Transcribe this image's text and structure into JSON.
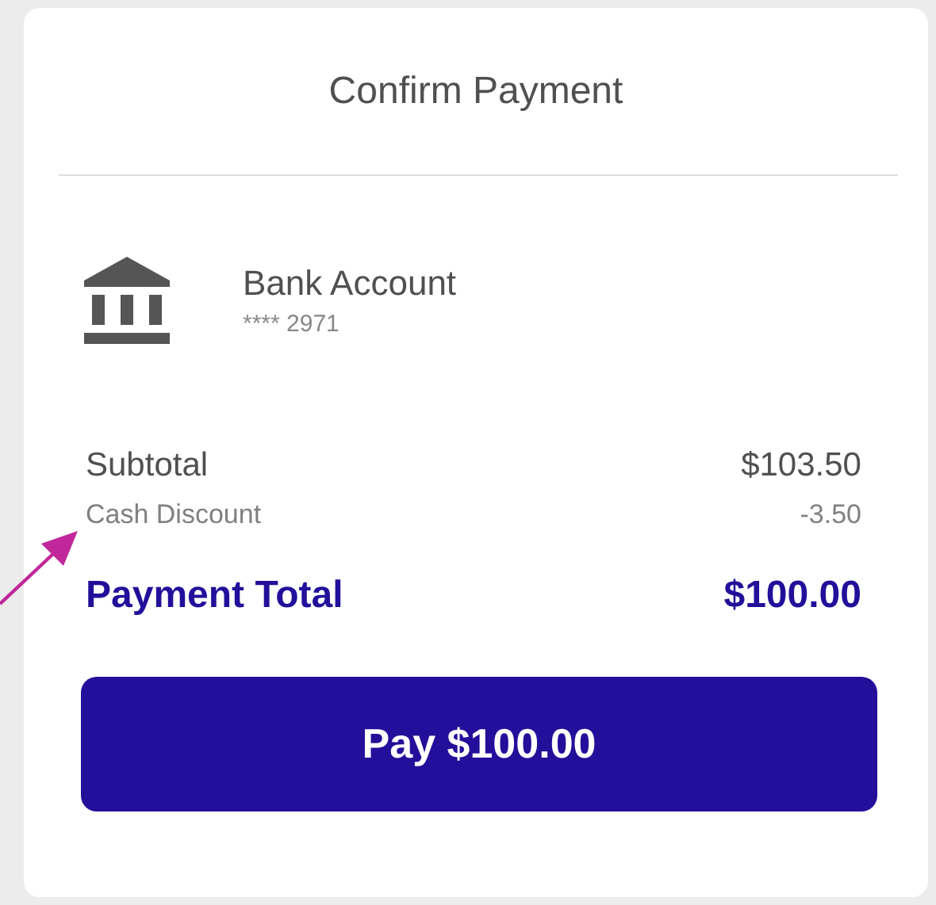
{
  "title": "Confirm Payment",
  "account": {
    "name": "Bank Account",
    "number": "**** 2971"
  },
  "lines": [
    {
      "label": "Subtotal",
      "amount": "$103.50",
      "kind": "primary"
    },
    {
      "label": "Cash Discount",
      "amount": "-3.50",
      "kind": "secondary"
    }
  ],
  "total": {
    "label": "Payment Total",
    "amount": "$100.00"
  },
  "button": "Pay $100.00"
}
